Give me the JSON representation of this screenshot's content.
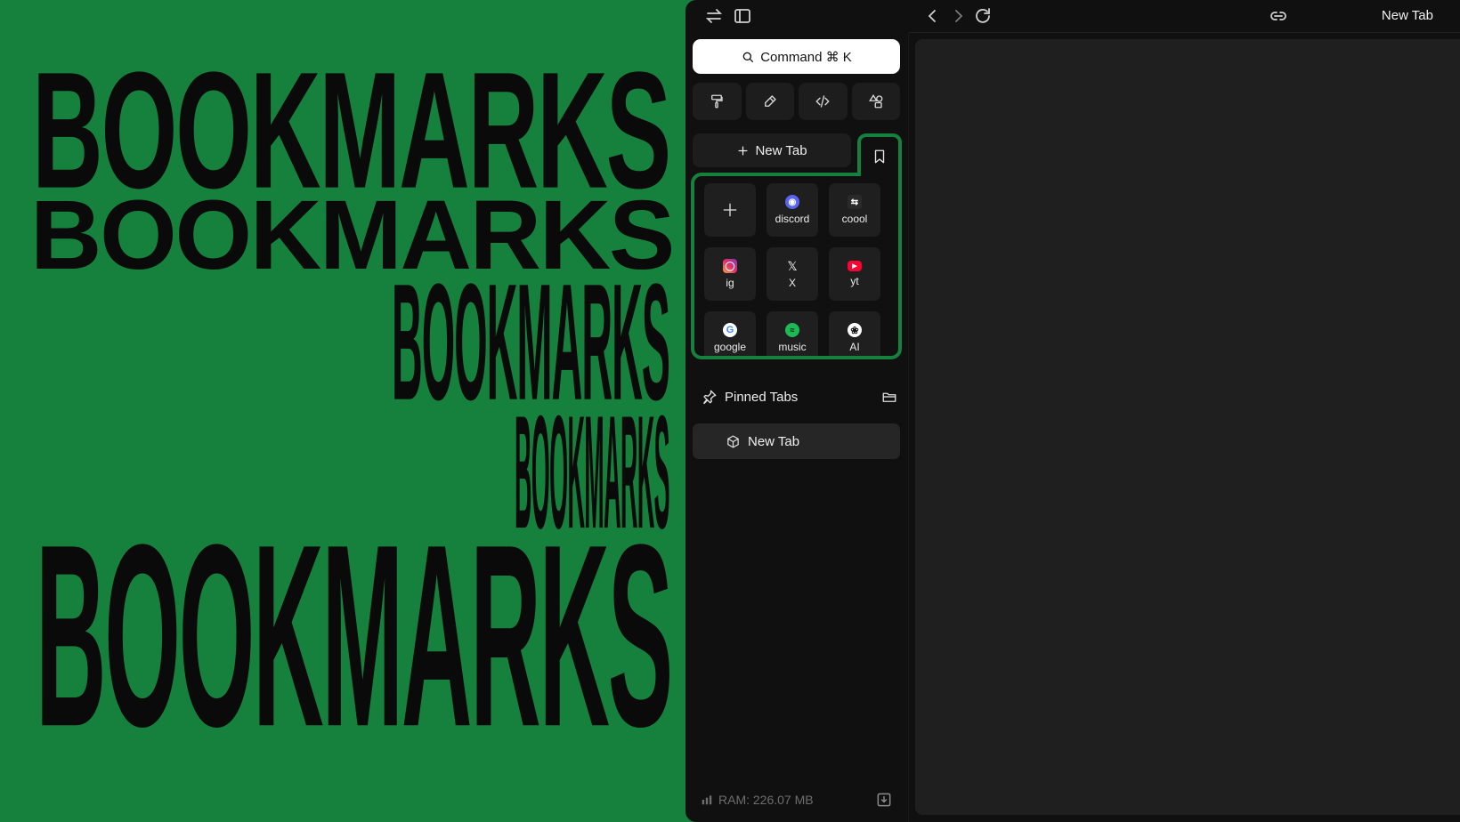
{
  "promo": {
    "words": [
      "BOOKMARKS",
      "BOOKMARKS",
      "BOOKMARKS",
      "BOOKMARKS",
      "BOOKMARKS"
    ]
  },
  "titlebar": {
    "tab_title": "New Tab"
  },
  "sidebar": {
    "command_label": "Command ⌘ K",
    "tools": [
      "paint-roller-icon",
      "pen-icon",
      "code-icon",
      "shapes-icon"
    ],
    "new_tab_label": "New Tab",
    "bookmarks": [
      {
        "label": "",
        "icon": "plus-icon"
      },
      {
        "label": "discord",
        "icon": "discord-icon",
        "color": "#5865F2"
      },
      {
        "label": "coool",
        "icon": "swap-icon",
        "color": "#2a2a2a"
      },
      {
        "label": "ig",
        "icon": "instagram-icon",
        "color": "#E1306C"
      },
      {
        "label": "X",
        "icon": "x-icon",
        "color": "#000000"
      },
      {
        "label": "yt",
        "icon": "youtube-icon",
        "color": "#FF0033"
      },
      {
        "label": "google",
        "icon": "google-icon",
        "color": "#ffffff"
      },
      {
        "label": "music",
        "icon": "spotify-icon",
        "color": "#1DB954"
      },
      {
        "label": "AI",
        "icon": "openai-icon",
        "color": "#ffffff"
      }
    ],
    "pinned_label": "Pinned Tabs",
    "pinned_tabs": [
      {
        "label": "New Tab"
      }
    ],
    "ram": "RAM: 226.07 MB"
  },
  "colors": {
    "accent": "#16813d",
    "window_bg": "#101010",
    "panel_bg": "#1f1f1f"
  }
}
